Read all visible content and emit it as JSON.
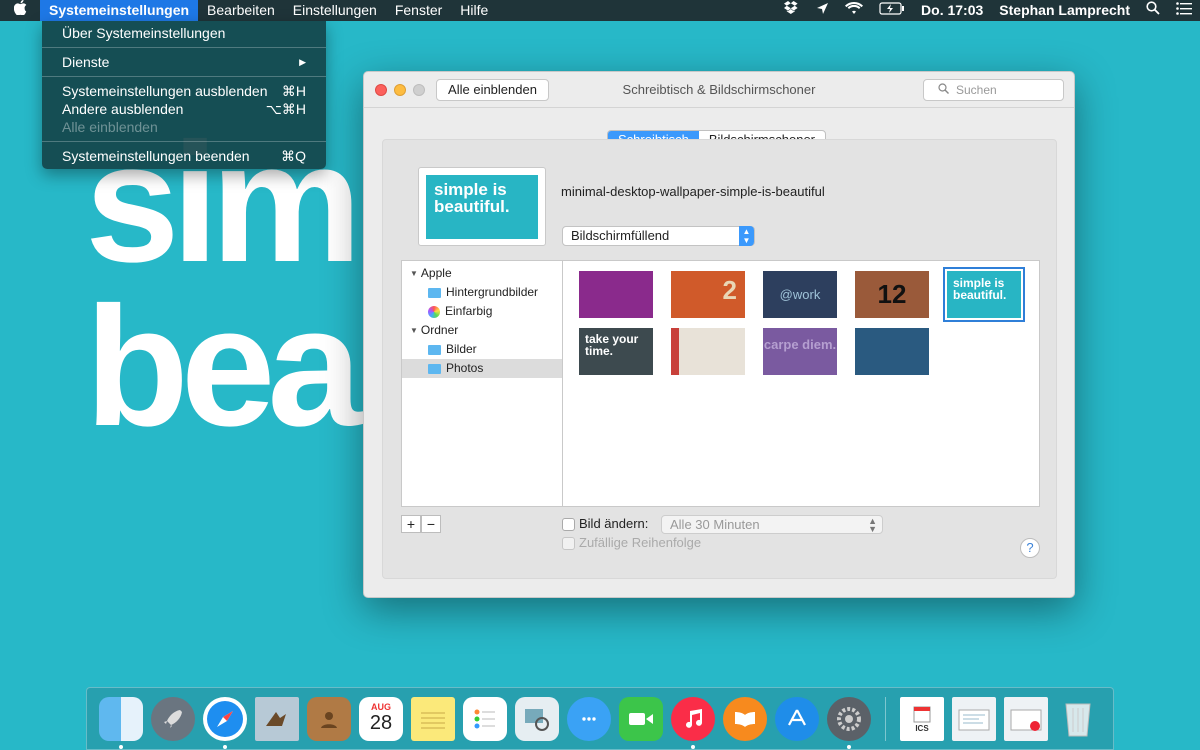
{
  "wallpaper": {
    "line1": "sim",
    "line2": "bea"
  },
  "menubar": {
    "apple": "",
    "items": [
      "Systemeinstellungen",
      "Bearbeiten",
      "Einstellungen",
      "Fenster",
      "Hilfe"
    ],
    "datetime": "Do. 17:03",
    "user": "Stephan Lamprecht"
  },
  "dropdown": {
    "about": "Über Systemeinstellungen",
    "services": "Dienste",
    "services_arrow": "▶",
    "hide": "Systemeinstellungen ausblenden",
    "hide_shortcut": "⌘H",
    "hide_others": "Andere ausblenden",
    "hide_others_shortcut": "⌥⌘H",
    "show_all": "Alle einblenden",
    "quit": "Systemeinstellungen beenden",
    "quit_shortcut": "⌘Q"
  },
  "window": {
    "show_all": "Alle einblenden",
    "title": "Schreibtisch & Bildschirmschoner",
    "search_placeholder": "Suchen",
    "tabs": [
      "Schreibtisch",
      "Bildschirmschoner"
    ],
    "preview_text": "simple is beautiful.",
    "wallpaper_name": "minimal-desktop-wallpaper-simple-is-beautiful",
    "fill_mode": "Bildschirmfüllend",
    "sources": {
      "apple": "Apple",
      "hintergrundbilder": "Hintergrundbilder",
      "einfarbig": "Einfarbig",
      "ordner": "Ordner",
      "bilder": "Bilder",
      "photos": "Photos"
    },
    "thumbs": [
      {
        "text": "",
        "bg": "#8a2a8c"
      },
      {
        "text": "2",
        "bg": "#d05a2a"
      },
      {
        "text": "@work",
        "bg": "#2d3f5e"
      },
      {
        "text": "12",
        "bg": "#9a5a3a"
      },
      {
        "text": "simple is beautiful.",
        "bg": "#28b5c4"
      },
      {
        "text": "take your time.",
        "bg": "#3d4a4f"
      },
      {
        "text": "",
        "bg": "#e8e2d8"
      },
      {
        "text": "carpe diem.",
        "bg": "#7a5aa0"
      },
      {
        "text": "",
        "bg": "#2a5a80"
      }
    ],
    "add": "+",
    "remove": "−",
    "change_picture": "Bild ändern:",
    "interval": "Alle 30 Minuten",
    "random": "Zufällige Reihenfolge",
    "help": "?"
  },
  "dock": {
    "calendar_month": "AUG",
    "calendar_day": "28",
    "ical_label": "ICS"
  }
}
